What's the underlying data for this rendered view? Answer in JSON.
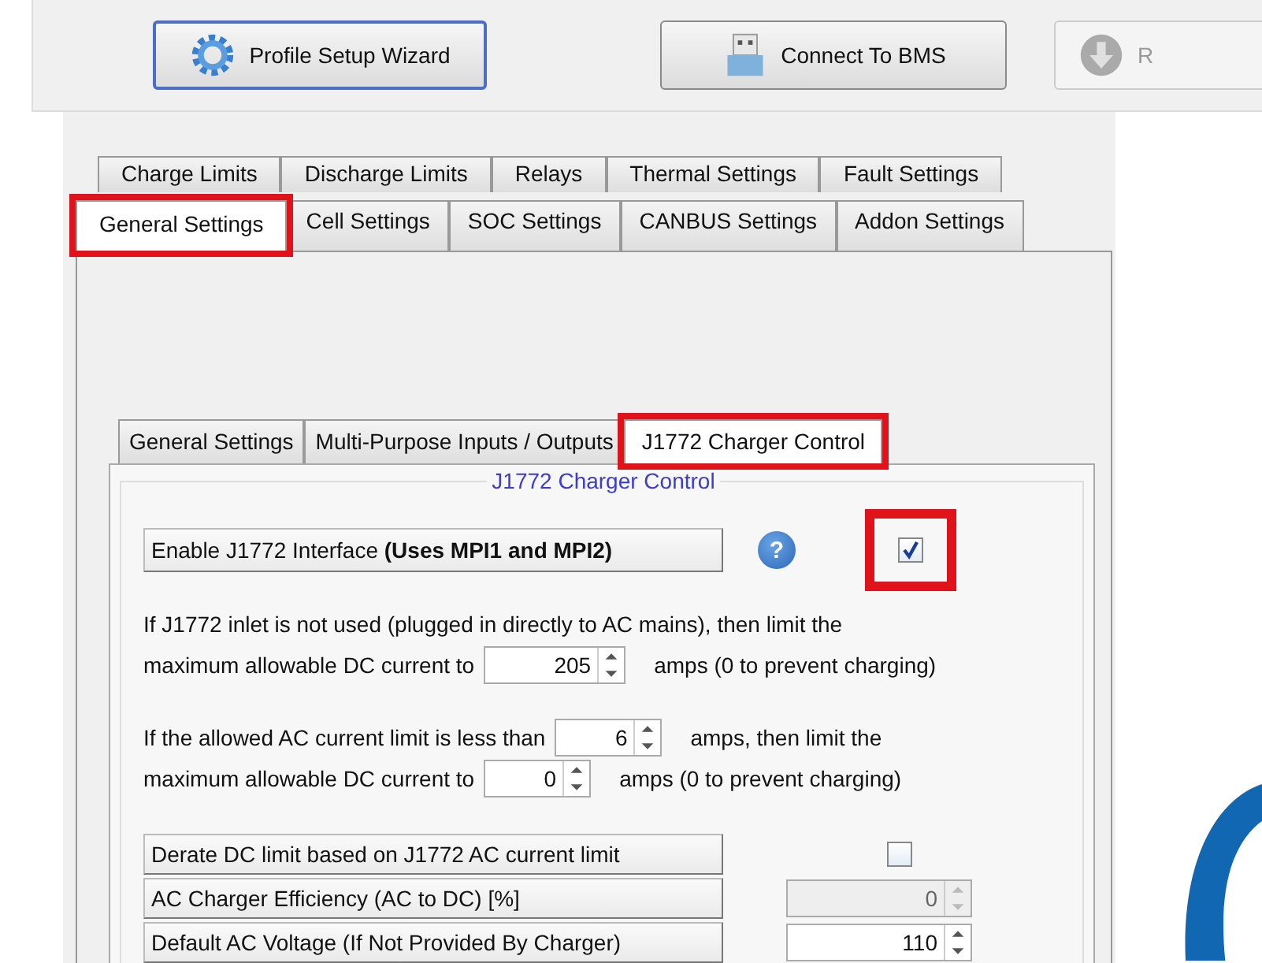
{
  "toolbar": {
    "buttons": [
      {
        "label": "Profile Setup Wizard",
        "selected": true
      },
      {
        "label": "Connect To BMS",
        "selected": false
      },
      {
        "label": "R",
        "selected": false
      }
    ]
  },
  "main_tabs": {
    "rows": [
      [
        {
          "label": "Charge Limits",
          "selected": false,
          "highlighted": false
        },
        {
          "label": "Discharge Limits",
          "selected": false,
          "highlighted": false
        },
        {
          "label": "Relays",
          "selected": false,
          "highlighted": false
        },
        {
          "label": "Thermal Settings",
          "selected": false,
          "highlighted": false
        },
        {
          "label": "Fault Settings",
          "selected": false,
          "highlighted": false
        }
      ],
      [
        {
          "label": "General Settings",
          "selected": true,
          "highlighted": true
        },
        {
          "label": "Cell Settings",
          "selected": false,
          "highlighted": false
        },
        {
          "label": "SOC Settings",
          "selected": false,
          "highlighted": false
        },
        {
          "label": "CANBUS Settings",
          "selected": false,
          "highlighted": false
        },
        {
          "label": "Addon Settings",
          "selected": false,
          "highlighted": false
        }
      ]
    ]
  },
  "sub_tabs": [
    {
      "label": "General Settings",
      "selected": false,
      "highlighted": false
    },
    {
      "label": "Multi-Purpose Inputs / Outputs",
      "selected": false,
      "highlighted": false
    },
    {
      "label": "J1772 Charger Control",
      "selected": true,
      "highlighted": true
    }
  ],
  "group": {
    "title": "J1772 Charger Control",
    "enable": {
      "label": "Enable J1772 Interface **(Uses MPI1 and MPI2)**",
      "help": "?",
      "checked": true,
      "highlighted": true
    },
    "paragraphs": [
      [
        [
          {
            "kind": "text",
            "text": "If J1772 inlet is not used (plugged in directly to AC mains), then limit the"
          }
        ],
        [
          {
            "kind": "text",
            "text": "maximum allowable DC current to"
          },
          {
            "kind": "spin",
            "value": "205",
            "disabled": false
          },
          {
            "kind": "text",
            "text": "amps (0 to prevent charging)"
          }
        ]
      ],
      [
        [
          {
            "kind": "text",
            "text": "If the allowed AC current limit is less than"
          },
          {
            "kind": "spin",
            "value": "6",
            "disabled": false
          },
          {
            "kind": "text",
            "text": "amps, then limit the"
          }
        ],
        [
          {
            "kind": "text",
            "text": "maximum allowable DC current to"
          },
          {
            "kind": "spin",
            "value": "0",
            "disabled": false
          },
          {
            "kind": "text",
            "text": "amps (0 to prevent charging)"
          }
        ]
      ]
    ],
    "settings": [
      {
        "label": "Derate DC limit based on J1772 AC current limit",
        "kind": "checkbox",
        "checked": false
      },
      {
        "label": "AC Charger Efficiency (AC to DC) [%]",
        "kind": "spin",
        "value": "0",
        "disabled": true
      },
      {
        "label": "Default AC Voltage (If Not Provided By Charger)",
        "kind": "spin",
        "value": "110",
        "disabled": false
      }
    ]
  }
}
